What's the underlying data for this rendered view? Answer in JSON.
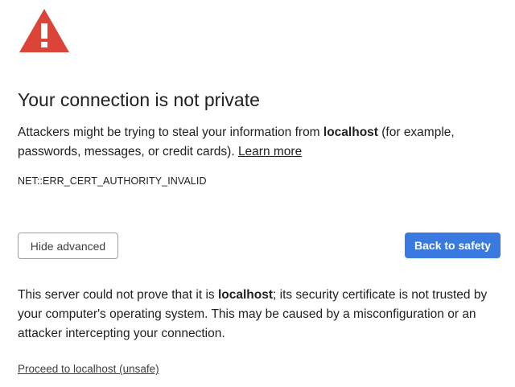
{
  "icon": {
    "name": "warning-icon",
    "color": "#db4437"
  },
  "heading": "Your connection is not private",
  "intro": {
    "before_host": "Attackers might be trying to steal your information from ",
    "host": "localhost",
    "after_host": " (for example, passwords, messages, or credit cards). ",
    "learn_more": "Learn more"
  },
  "error_code": "NET::ERR_CERT_AUTHORITY_INVALID",
  "buttons": {
    "hide_advanced": "Hide advanced",
    "back_to_safety": "Back to safety"
  },
  "details": {
    "before_host": "This server could not prove that it is ",
    "host": "localhost",
    "after_host": "; its security certificate is not trusted by your computer's operating system. This may be caused by a misconfiguration or an attacker intercepting your connection."
  },
  "proceed_link": "Proceed to localhost (unsafe)",
  "colors": {
    "primary_button": "#3a7ae0",
    "warning_red": "#db4437"
  }
}
